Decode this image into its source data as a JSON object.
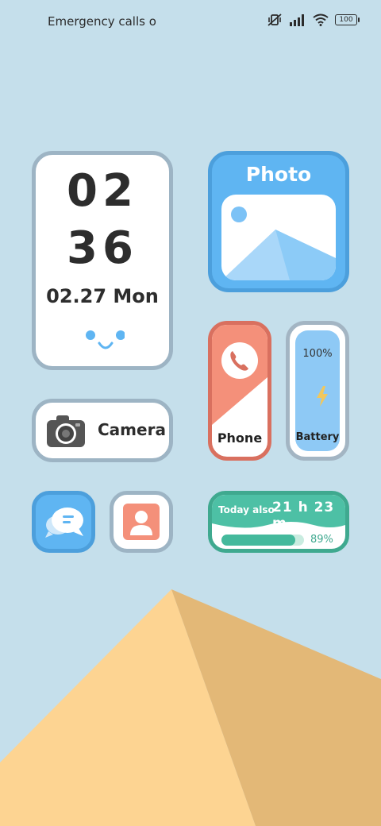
{
  "status_bar": {
    "left_text": "Emergency calls o",
    "battery_level": "100"
  },
  "clock_widget": {
    "hour": "02",
    "minute": "36",
    "date": "02.27 Mon"
  },
  "photo_widget": {
    "title": "Photo"
  },
  "phone_widget": {
    "label": "Phone",
    "icon": "phone-icon"
  },
  "battery_widget": {
    "percent_text": "100%",
    "label": "Battery",
    "icon": "lightning-bolt-icon"
  },
  "camera_widget": {
    "label": "Camera",
    "icon": "camera-icon"
  },
  "messages_widget": {
    "icon": "chat-bubbles-icon"
  },
  "contacts_widget": {
    "icon": "contact-card-icon"
  },
  "screen_time_widget": {
    "label": "Today also",
    "time_text": "21 h 23 m",
    "percent_text": "89%",
    "progress": 0.89
  },
  "colors": {
    "background": "#c5dfeb",
    "sand_light": "#fdd492",
    "sand_dark": "#e3b877",
    "blue_accent": "#5fb5f2",
    "coral_accent": "#f4907a",
    "green_accent": "#4dc0a5"
  }
}
